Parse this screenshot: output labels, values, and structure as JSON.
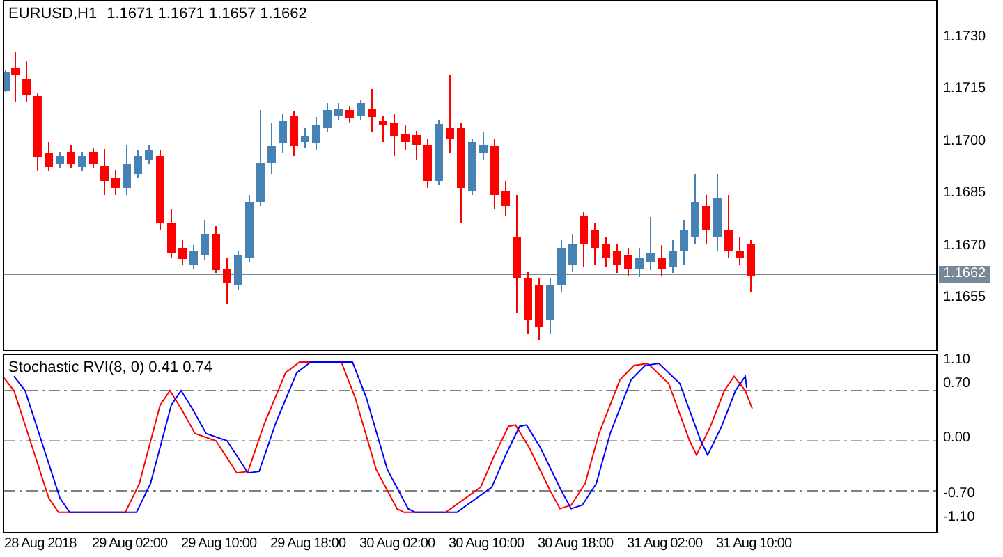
{
  "chart": {
    "symbol": "EURUSD,H1",
    "ohlc": "1.1671 1.1671 1.1657 1.1662"
  },
  "price_axis": {
    "labels": [
      "1.1730",
      "1.1715",
      "1.1700",
      "1.1685",
      "1.1670",
      "1.1655"
    ],
    "current_price": "1.1662"
  },
  "indicator": {
    "label": "Stochastic RVI(8, 0) 0.41 0.74",
    "axis_labels": [
      "1.10",
      "0.70",
      "0.00",
      "-0.70",
      "-1.10"
    ]
  },
  "time_axis": [
    "28 Aug 2018",
    "29 Aug 02:00",
    "29 Aug 10:00",
    "29 Aug 18:00",
    "30 Aug 02:00",
    "30 Aug 10:00",
    "30 Aug 18:00",
    "31 Aug 02:00",
    "31 Aug 10:00"
  ]
}
